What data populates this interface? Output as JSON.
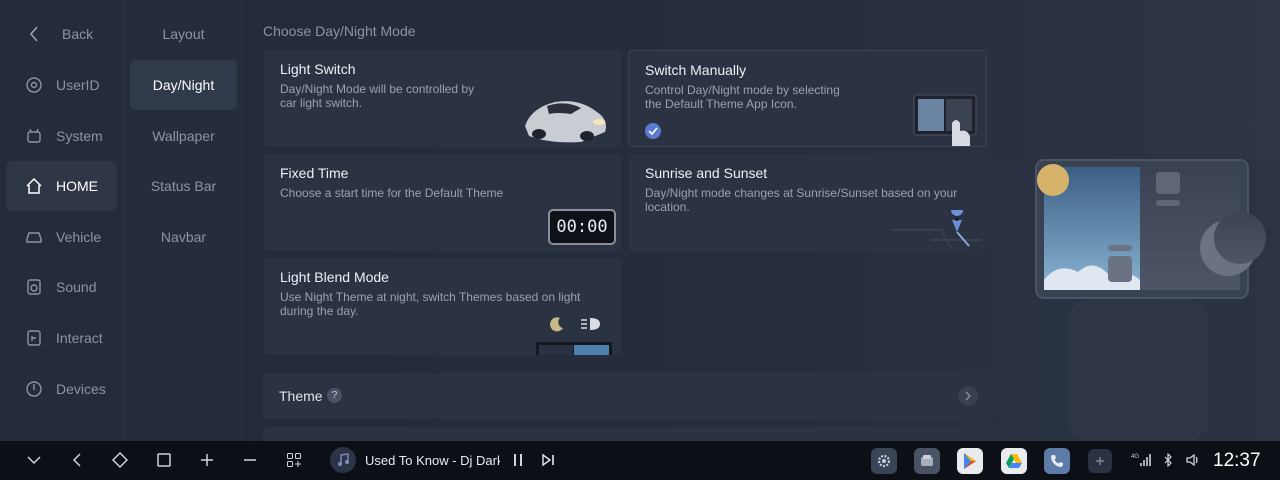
{
  "nav_primary": {
    "back": "Back",
    "items": [
      {
        "label": "UserID",
        "icon": "userid-icon"
      },
      {
        "label": "System",
        "icon": "system-icon"
      },
      {
        "label": "HOME",
        "icon": "home-icon",
        "active": true
      },
      {
        "label": "Vehicle",
        "icon": "vehicle-icon"
      },
      {
        "label": "Sound",
        "icon": "speaker-icon"
      },
      {
        "label": "Interact",
        "icon": "interact-icon"
      },
      {
        "label": "Devices",
        "icon": "power-icon"
      }
    ]
  },
  "nav_secondary": {
    "items": [
      "Layout",
      "Day/Night",
      "Wallpaper",
      "Status Bar",
      "Navbar"
    ],
    "active": "Day/Night"
  },
  "main": {
    "section_title": "Choose Day/Night Mode",
    "cards": {
      "light_switch": {
        "title": "Light Switch",
        "desc": "Day/Night Mode will be controlled by car light switch."
      },
      "switch_manually": {
        "title": "Switch Manually",
        "desc": "Control Day/Night mode by selecting the Default Theme App Icon.",
        "selected": true
      },
      "fixed_time": {
        "title": "Fixed Time",
        "desc": "Choose a start time for the Default Theme",
        "clock": "00:00"
      },
      "sunrise_sunset": {
        "title": "Sunrise and Sunset",
        "desc": "Day/Night mode changes at Sunrise/Sunset based on your location."
      },
      "light_blend": {
        "title": "Light Blend Mode",
        "desc": "Use Night Theme at night, switch Themes based on light during the day."
      }
    },
    "theme_row": {
      "label": "Theme",
      "help": "?"
    }
  },
  "taskbar": {
    "media_title": "Used To Know - Dj Dark",
    "clock": "12:37",
    "signal": "4G",
    "colors": {
      "accent": "#5b7bd1",
      "background": "#0c0f16"
    }
  }
}
